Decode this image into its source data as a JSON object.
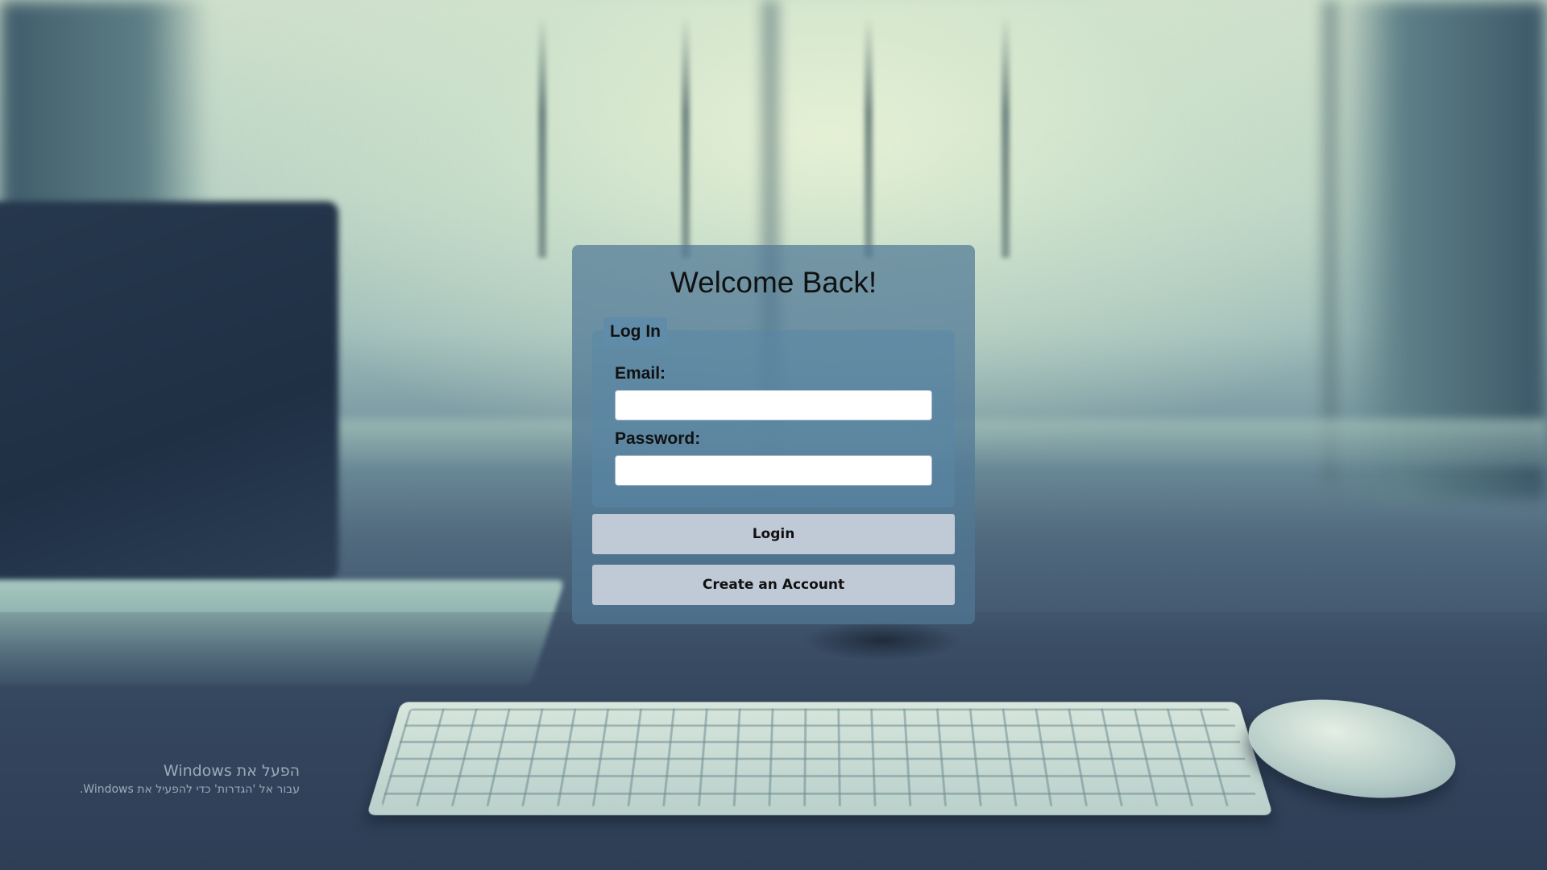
{
  "page": {
    "title": "Welcome Back!"
  },
  "login": {
    "legend": "Log In",
    "email_label": "Email:",
    "email_value": "",
    "password_label": "Password:",
    "password_value": "",
    "login_button": "Login",
    "create_account_button": "Create an Account"
  },
  "watermark": {
    "title": "הפעל את Windows",
    "subtitle": "עבור אל 'הגדרות' כדי להפעיל את Windows."
  },
  "colors": {
    "card_bg": "#50789699",
    "button_bg": "#c0c9d6",
    "text": "#111111"
  }
}
